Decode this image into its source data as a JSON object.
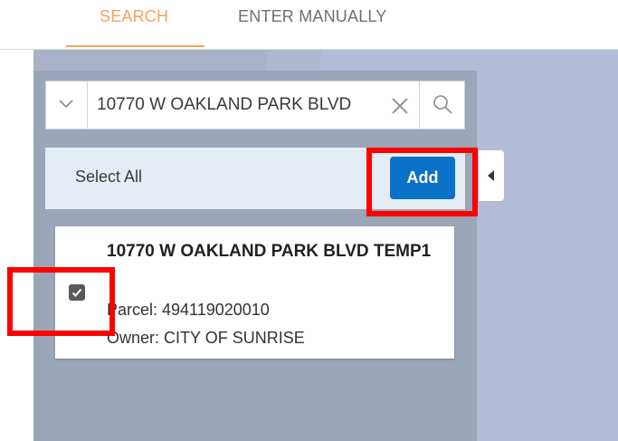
{
  "tabs": {
    "search": "SEARCH",
    "manual": "ENTER MANUALLY"
  },
  "search": {
    "value": "10770 W OAKLAND PARK BLVD"
  },
  "toolbar": {
    "select_all_label": "Select All",
    "add_label": "Add"
  },
  "result": {
    "title": "10770 W OAKLAND PARK BLVD TEMP1",
    "parcel": "Parcel: 494119020010",
    "owner": "Owner: CITY OF SUNRISE",
    "checked": true
  },
  "icons": {
    "dropdown": "chevron-down-icon",
    "clear": "close-icon",
    "search": "search-icon",
    "collapse": "caret-left-icon",
    "checkbox": "check-icon"
  },
  "colors": {
    "accent_tab": "#f6a35b",
    "add_button": "#0a71c8",
    "highlight": "#ff0000"
  }
}
